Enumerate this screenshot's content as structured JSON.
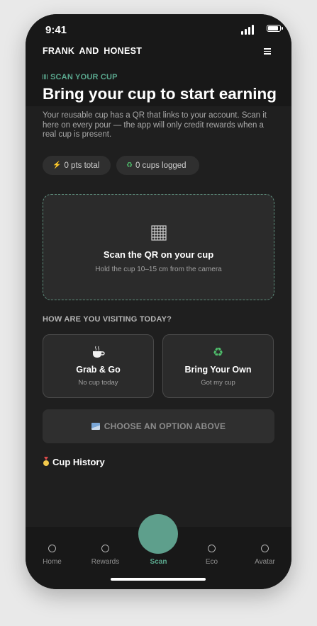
{
  "status": {
    "time": "9:41"
  },
  "header": {
    "brand": "FRANK AND HONEST"
  },
  "hero": {
    "eyebrow": "SCAN YOUR CUP",
    "title": "Bring your cup to start earning",
    "description": "Your reusable cup has a QR that links to your account. Scan it here on every pour — the app will only credit rewards when a real cup is present."
  },
  "stats": {
    "points": "0 pts total",
    "cups": "0 cups logged",
    "points_icon": "lightning-icon",
    "cups_icon": "recycle-icon"
  },
  "scanner": {
    "title": "Scan the QR on your cup",
    "subtitle": "Hold the cup 10–15 cm from the camera",
    "icon": "qr-icon"
  },
  "visit": {
    "label": "HOW ARE YOU VISITING TODAY?",
    "options": [
      {
        "title": "Grab & Go",
        "subtitle": "No cup today",
        "icon": "coffee-cup-icon"
      },
      {
        "title": "Bring Your Own",
        "subtitle": "Got my cup",
        "icon": "recycle-icon"
      }
    ]
  },
  "cta": {
    "label": "CHOOSE AN OPTION ABOVE"
  },
  "history": {
    "title": "Cup History"
  },
  "nav": {
    "items": [
      {
        "label": "Home"
      },
      {
        "label": "Rewards"
      },
      {
        "label": "Scan",
        "active": true
      },
      {
        "label": "Eco"
      },
      {
        "label": "Avatar"
      }
    ]
  },
  "colors": {
    "accent": "#5aa88e",
    "background": "#1f1f1f",
    "card": "#2b2b2b",
    "fab": "#5e9f8c"
  }
}
